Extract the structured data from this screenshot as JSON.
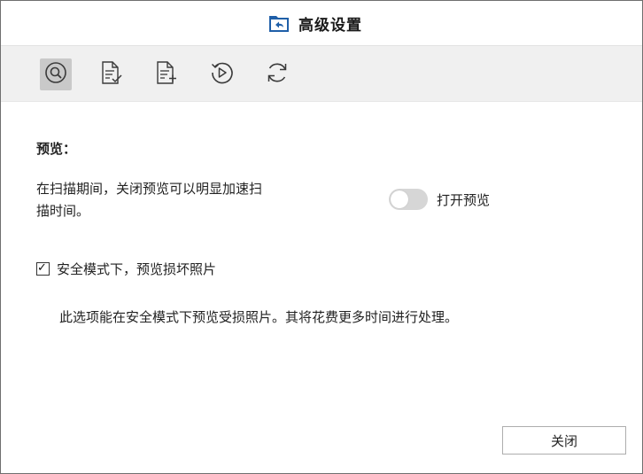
{
  "window": {
    "title": "高级设置",
    "title_icon": "restore-folder-icon"
  },
  "toolbar": {
    "items": [
      {
        "icon": "search-circle-icon",
        "active": true
      },
      {
        "icon": "document-check-icon",
        "active": false
      },
      {
        "icon": "document-add-icon",
        "active": false
      },
      {
        "icon": "play-circle-icon",
        "active": false
      },
      {
        "icon": "refresh-icon",
        "active": false
      }
    ]
  },
  "preview": {
    "section_title": "预览：",
    "description_line1": "在扫描期间，关闭预览可以明显加速扫",
    "description_line2": "描时间。",
    "toggle_label": "打开预览",
    "toggle_on": false
  },
  "safe_mode": {
    "checkbox_label": "安全模式下，预览损坏照片",
    "checked": true,
    "note": "此选项能在安全模式下预览受损照片。其将花费更多时间进行处理。"
  },
  "footer": {
    "close_label": "关闭"
  },
  "colors": {
    "toolbar_bg": "#f0f0f0",
    "active_tool_bg": "#c9c9c9",
    "icon_blue": "#1f5fa8",
    "toggle_off": "#d6d6d6",
    "border": "#6f6f6f"
  }
}
